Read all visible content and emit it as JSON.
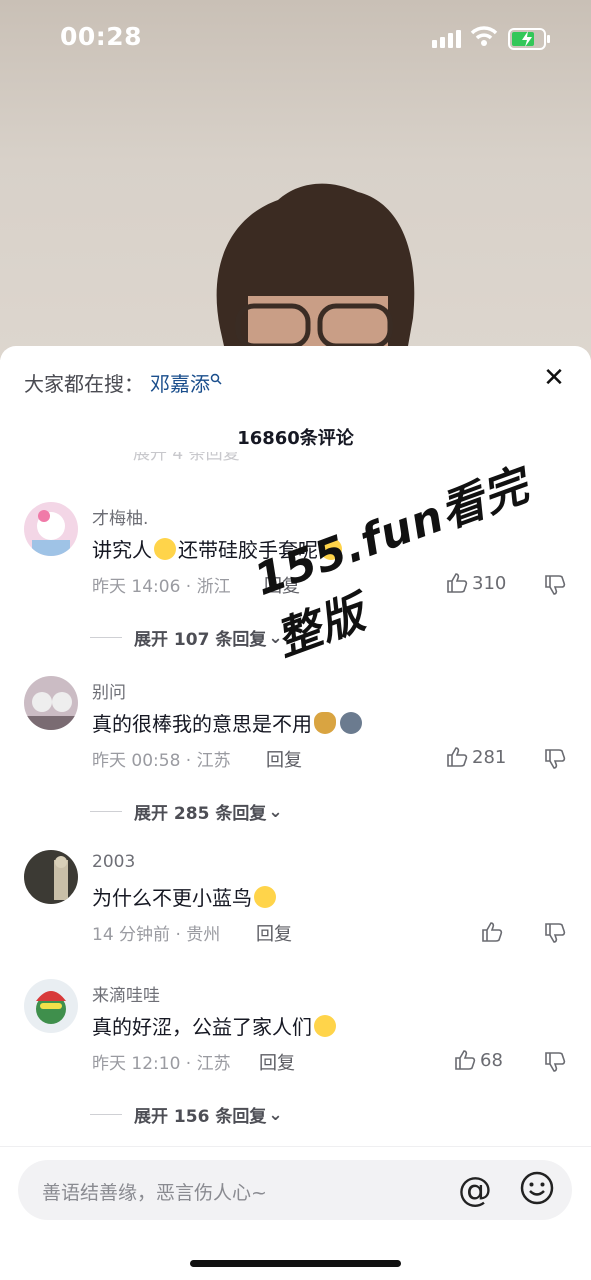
{
  "status_bar": {
    "time": "00:28"
  },
  "search_bar": {
    "prefix": "大家都在搜：",
    "keyword": "邓嘉添"
  },
  "comments_header": {
    "title": "16860条评论"
  },
  "comments": [
    {
      "user": "才梅柚.",
      "text": "讲究人",
      "text2": "还带硅胶手套呢",
      "time_location": "昨天 14:06 · 浙江",
      "reply_label": "回复",
      "likes": "310",
      "expand_label": "展开 107 条回复"
    },
    {
      "user": "别问",
      "text": "真的很棒我的意思是不用",
      "time_location": "昨天 00:58 · 江苏",
      "reply_label": "回复",
      "likes": "281",
      "expand_label": "展开 285 条回复"
    },
    {
      "user": "2003",
      "text": "为什么不更小蓝鸟",
      "time_location": "14 分钟前 · 贵州",
      "reply_label": "回复",
      "likes": "",
      "expand_label": ""
    },
    {
      "user": "来滴哇哇",
      "text": "真的好涩，公益了家人们",
      "time_location": "昨天 12:10 · 江苏",
      "reply_label": "回复",
      "likes": "68",
      "expand_label": "展开 156 条回复"
    }
  ],
  "watermark": "155.fun看完整版",
  "comment_input": {
    "placeholder": "善语结善缘，恶言伤人心~"
  },
  "icons": {
    "close": "close-icon",
    "at": "at-icon",
    "emoji": "emoji-icon",
    "like": "thumb-up-icon",
    "dislike": "thumb-down-icon"
  }
}
